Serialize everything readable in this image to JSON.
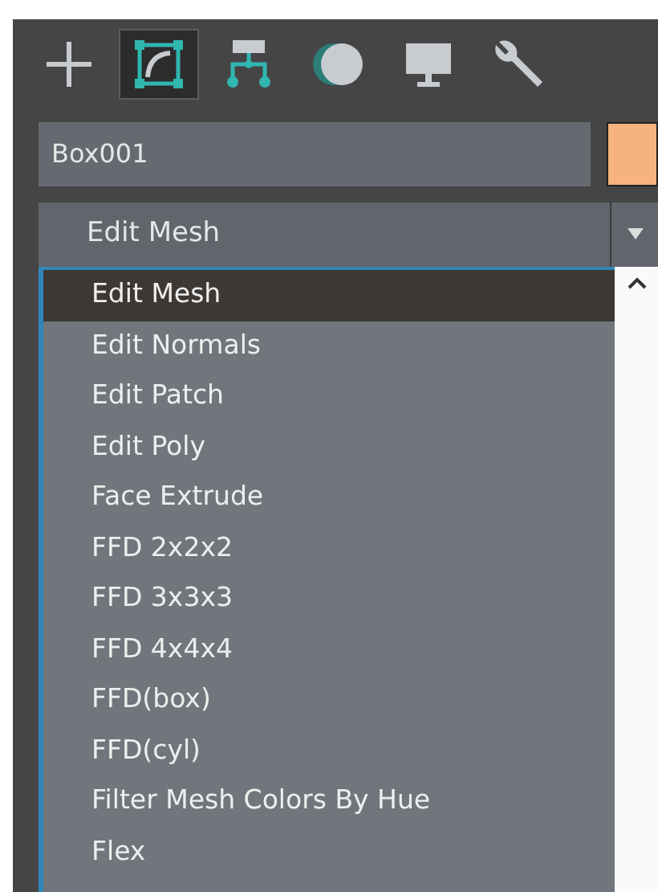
{
  "tabs": [
    {
      "kind": "create",
      "selected": false
    },
    {
      "kind": "modify",
      "selected": true
    },
    {
      "kind": "hierarchy",
      "selected": false
    },
    {
      "kind": "motion",
      "selected": false
    },
    {
      "kind": "display",
      "selected": false
    },
    {
      "kind": "utilities",
      "selected": false
    }
  ],
  "object_name": {
    "value": "Box001",
    "color": "#f6b37f"
  },
  "modifier_dropdown": {
    "value": "Edit Mesh",
    "expanded": true
  },
  "modifier_list": [
    {
      "label": "Edit Mesh",
      "selected": true
    },
    {
      "label": "Edit Normals",
      "selected": false
    },
    {
      "label": "Edit Patch",
      "selected": false
    },
    {
      "label": "Edit Poly",
      "selected": false
    },
    {
      "label": "Face Extrude",
      "selected": false
    },
    {
      "label": "FFD 2x2x2",
      "selected": false
    },
    {
      "label": "FFD 3x3x3",
      "selected": false
    },
    {
      "label": "FFD 4x4x4",
      "selected": false
    },
    {
      "label": "FFD(box)",
      "selected": false
    },
    {
      "label": "FFD(cyl)",
      "selected": false
    },
    {
      "label": "Filter Mesh Colors By Hue",
      "selected": false
    },
    {
      "label": "Flex",
      "selected": false
    }
  ]
}
